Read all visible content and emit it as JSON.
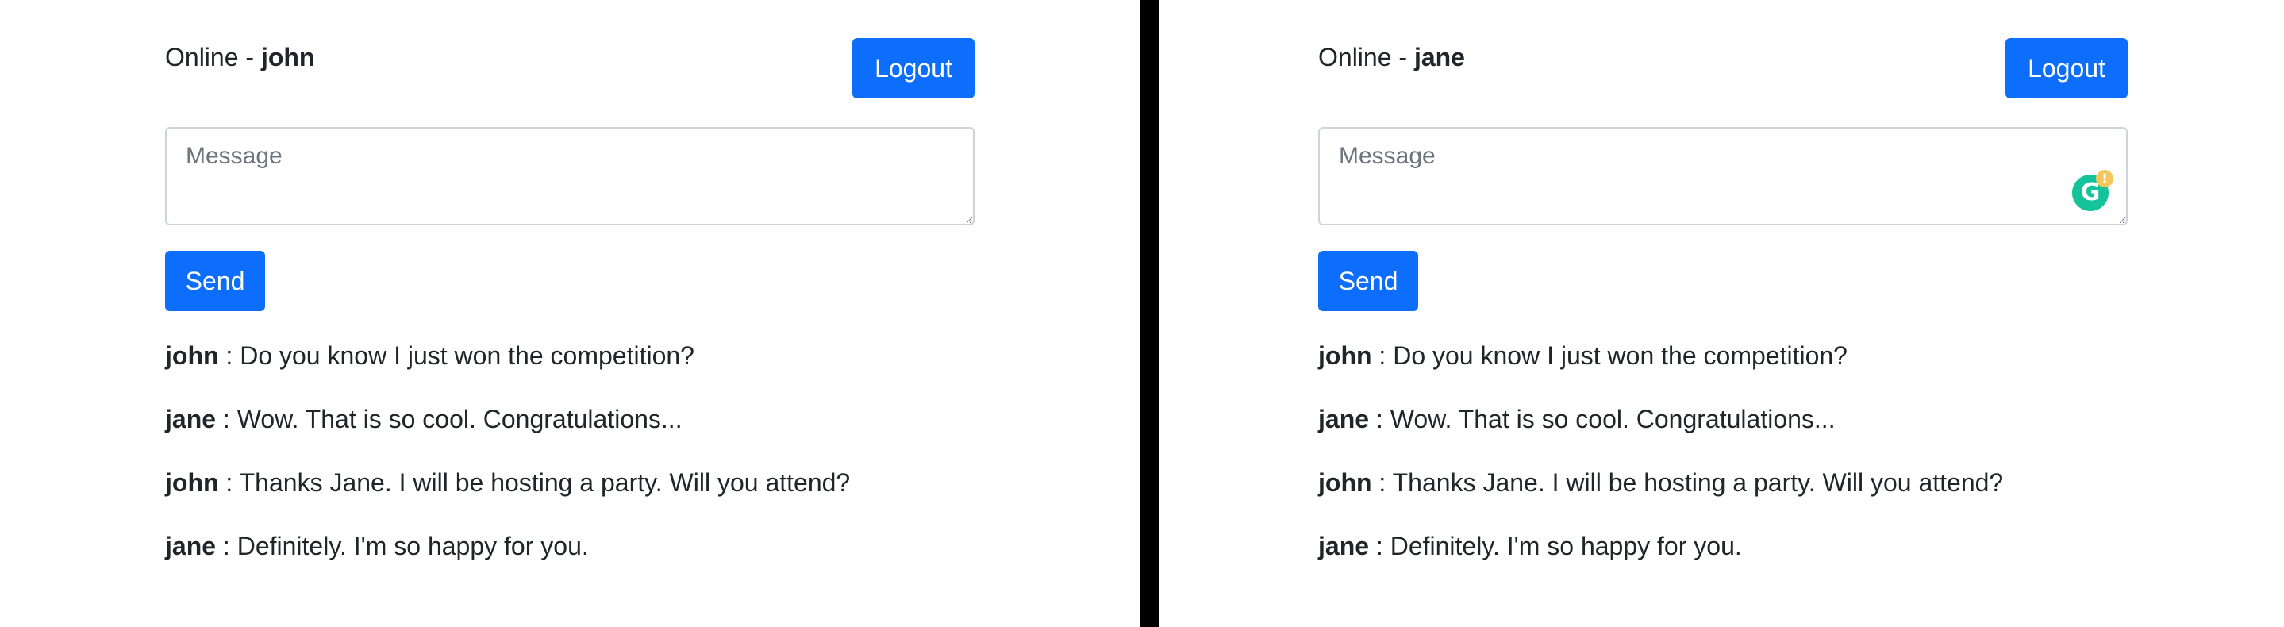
{
  "panes": [
    {
      "status_prefix": "Online - ",
      "username": "john",
      "logout_label": "Logout",
      "message_placeholder": "Message",
      "send_label": "Send",
      "grammarly": false,
      "messages": [
        {
          "sender": "john",
          "separator": " : ",
          "text": "Do you know I just won the competition?"
        },
        {
          "sender": "jane",
          "separator": " : ",
          "text": "Wow. That is so cool. Congratulations..."
        },
        {
          "sender": "john",
          "separator": " : ",
          "text": "Thanks Jane. I will be hosting a party. Will you attend?"
        },
        {
          "sender": "jane",
          "separator": " : ",
          "text": "Definitely. I'm so happy for you."
        }
      ]
    },
    {
      "status_prefix": "Online - ",
      "username": "jane",
      "logout_label": "Logout",
      "message_placeholder": "Message",
      "send_label": "Send",
      "grammarly": true,
      "grammarly_icon": "grammarly-icon",
      "grammarly_letter": "G",
      "grammarly_alert": "!",
      "messages": [
        {
          "sender": "john",
          "separator": " : ",
          "text": "Do you know I just won the competition?"
        },
        {
          "sender": "jane",
          "separator": " : ",
          "text": "Wow. That is so cool. Congratulations..."
        },
        {
          "sender": "john",
          "separator": " : ",
          "text": "Thanks Jane. I will be hosting a party. Will you attend?"
        },
        {
          "sender": "jane",
          "separator": " : ",
          "text": "Definitely. I'm so happy for you."
        }
      ]
    }
  ],
  "colors": {
    "primary": "#0d6efd",
    "divider": "#000000",
    "grammarly": "#15c39a",
    "grammarly_alert": "#f5c65b"
  }
}
